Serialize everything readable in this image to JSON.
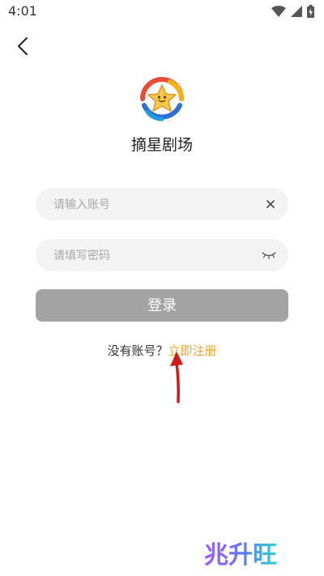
{
  "status_bar": {
    "time": "4:01",
    "icons": [
      "wifi-icon",
      "cellular-signal-icon",
      "battery-charging-icon"
    ]
  },
  "nav": {
    "back_icon": "chevron-left-icon"
  },
  "app": {
    "name": "摘星剧场",
    "logo_icon": "star-face-logo"
  },
  "form": {
    "account_placeholder": "请输入账号",
    "account_value": "",
    "account_clear_icon": "close-icon",
    "password_placeholder": "请填写密码",
    "password_value": "",
    "password_toggle_icon": "eye-closed-icon",
    "login_label": "登录"
  },
  "register": {
    "prompt": "没有账号？",
    "link_label": "立即注册"
  },
  "annotation": {
    "arrow_icon": "red-arrow-up-icon"
  },
  "watermark": {
    "text": "兆升旺"
  },
  "colors": {
    "accent": "#f5a623",
    "login_button": "#a3a3a3",
    "field_background": "#f3f3f3",
    "annotation_arrow": "#d21a1a"
  }
}
